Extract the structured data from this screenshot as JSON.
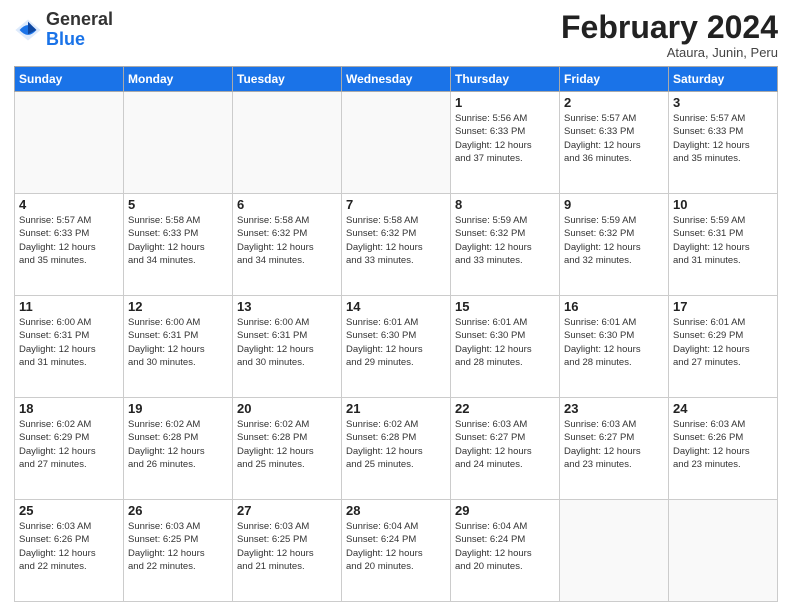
{
  "logo": {
    "general": "General",
    "blue": "Blue"
  },
  "header": {
    "month": "February 2024",
    "location": "Ataura, Junin, Peru"
  },
  "weekdays": [
    "Sunday",
    "Monday",
    "Tuesday",
    "Wednesday",
    "Thursday",
    "Friday",
    "Saturday"
  ],
  "weeks": [
    [
      {
        "day": "",
        "info": ""
      },
      {
        "day": "",
        "info": ""
      },
      {
        "day": "",
        "info": ""
      },
      {
        "day": "",
        "info": ""
      },
      {
        "day": "1",
        "info": "Sunrise: 5:56 AM\nSunset: 6:33 PM\nDaylight: 12 hours\nand 37 minutes."
      },
      {
        "day": "2",
        "info": "Sunrise: 5:57 AM\nSunset: 6:33 PM\nDaylight: 12 hours\nand 36 minutes."
      },
      {
        "day": "3",
        "info": "Sunrise: 5:57 AM\nSunset: 6:33 PM\nDaylight: 12 hours\nand 35 minutes."
      }
    ],
    [
      {
        "day": "4",
        "info": "Sunrise: 5:57 AM\nSunset: 6:33 PM\nDaylight: 12 hours\nand 35 minutes."
      },
      {
        "day": "5",
        "info": "Sunrise: 5:58 AM\nSunset: 6:33 PM\nDaylight: 12 hours\nand 34 minutes."
      },
      {
        "day": "6",
        "info": "Sunrise: 5:58 AM\nSunset: 6:32 PM\nDaylight: 12 hours\nand 34 minutes."
      },
      {
        "day": "7",
        "info": "Sunrise: 5:58 AM\nSunset: 6:32 PM\nDaylight: 12 hours\nand 33 minutes."
      },
      {
        "day": "8",
        "info": "Sunrise: 5:59 AM\nSunset: 6:32 PM\nDaylight: 12 hours\nand 33 minutes."
      },
      {
        "day": "9",
        "info": "Sunrise: 5:59 AM\nSunset: 6:32 PM\nDaylight: 12 hours\nand 32 minutes."
      },
      {
        "day": "10",
        "info": "Sunrise: 5:59 AM\nSunset: 6:31 PM\nDaylight: 12 hours\nand 31 minutes."
      }
    ],
    [
      {
        "day": "11",
        "info": "Sunrise: 6:00 AM\nSunset: 6:31 PM\nDaylight: 12 hours\nand 31 minutes."
      },
      {
        "day": "12",
        "info": "Sunrise: 6:00 AM\nSunset: 6:31 PM\nDaylight: 12 hours\nand 30 minutes."
      },
      {
        "day": "13",
        "info": "Sunrise: 6:00 AM\nSunset: 6:31 PM\nDaylight: 12 hours\nand 30 minutes."
      },
      {
        "day": "14",
        "info": "Sunrise: 6:01 AM\nSunset: 6:30 PM\nDaylight: 12 hours\nand 29 minutes."
      },
      {
        "day": "15",
        "info": "Sunrise: 6:01 AM\nSunset: 6:30 PM\nDaylight: 12 hours\nand 28 minutes."
      },
      {
        "day": "16",
        "info": "Sunrise: 6:01 AM\nSunset: 6:30 PM\nDaylight: 12 hours\nand 28 minutes."
      },
      {
        "day": "17",
        "info": "Sunrise: 6:01 AM\nSunset: 6:29 PM\nDaylight: 12 hours\nand 27 minutes."
      }
    ],
    [
      {
        "day": "18",
        "info": "Sunrise: 6:02 AM\nSunset: 6:29 PM\nDaylight: 12 hours\nand 27 minutes."
      },
      {
        "day": "19",
        "info": "Sunrise: 6:02 AM\nSunset: 6:28 PM\nDaylight: 12 hours\nand 26 minutes."
      },
      {
        "day": "20",
        "info": "Sunrise: 6:02 AM\nSunset: 6:28 PM\nDaylight: 12 hours\nand 25 minutes."
      },
      {
        "day": "21",
        "info": "Sunrise: 6:02 AM\nSunset: 6:28 PM\nDaylight: 12 hours\nand 25 minutes."
      },
      {
        "day": "22",
        "info": "Sunrise: 6:03 AM\nSunset: 6:27 PM\nDaylight: 12 hours\nand 24 minutes."
      },
      {
        "day": "23",
        "info": "Sunrise: 6:03 AM\nSunset: 6:27 PM\nDaylight: 12 hours\nand 23 minutes."
      },
      {
        "day": "24",
        "info": "Sunrise: 6:03 AM\nSunset: 6:26 PM\nDaylight: 12 hours\nand 23 minutes."
      }
    ],
    [
      {
        "day": "25",
        "info": "Sunrise: 6:03 AM\nSunset: 6:26 PM\nDaylight: 12 hours\nand 22 minutes."
      },
      {
        "day": "26",
        "info": "Sunrise: 6:03 AM\nSunset: 6:25 PM\nDaylight: 12 hours\nand 22 minutes."
      },
      {
        "day": "27",
        "info": "Sunrise: 6:03 AM\nSunset: 6:25 PM\nDaylight: 12 hours\nand 21 minutes."
      },
      {
        "day": "28",
        "info": "Sunrise: 6:04 AM\nSunset: 6:24 PM\nDaylight: 12 hours\nand 20 minutes."
      },
      {
        "day": "29",
        "info": "Sunrise: 6:04 AM\nSunset: 6:24 PM\nDaylight: 12 hours\nand 20 minutes."
      },
      {
        "day": "",
        "info": ""
      },
      {
        "day": "",
        "info": ""
      }
    ]
  ]
}
